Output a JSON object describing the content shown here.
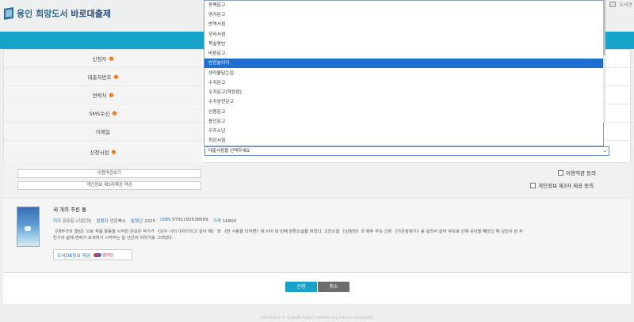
{
  "header": {
    "logo_text_main": "용인 희망도서",
    "logo_text_accent": "바로대출제",
    "top_right_text": "도서관"
  },
  "form": {
    "rows": [
      {
        "label": "신청자",
        "required": true
      },
      {
        "label": "대출자번호",
        "required": true
      },
      {
        "label": "연락처",
        "required": true
      },
      {
        "label": "SMS수신",
        "required": true
      },
      {
        "label": "이메일",
        "required": false
      },
      {
        "label": "신청서점",
        "required": true
      }
    ],
    "required_mark": "●",
    "store_select": {
      "value": "대출서점을 선택하세요",
      "arrow": "⌄"
    }
  },
  "dropdown": {
    "options": [
      "동백문고",
      "명지문고",
      "번역서점",
      "모리서점",
      "북실평빈",
      "바른문고",
      "반란놀이터",
      "생각을담는집",
      "수지문고",
      "수지문고(학원점)",
      "수지상현문고",
      "신봉문고",
      "용인문고",
      "우주소년",
      "최강서점"
    ],
    "selected": "반란놀이터"
  },
  "agreements": {
    "terms_button": "이용약관보기",
    "privacy_button": "개인정보 제3자제공 약관",
    "terms_check": "이용약관 동의",
    "privacy_check": "개인정보 제3자 제공 동의"
  },
  "book": {
    "title": "세 개의 푸른 돌",
    "author_label": "저자",
    "author": "은모든 (지은이)",
    "publisher_label": "발행자",
    "publisher": "안온북스",
    "year_label": "발행년",
    "year": "2025",
    "isbn_label": "ISBN",
    "isbn": "9791192638669",
    "price_label": "가격",
    "price": "16800",
    "desc_line1": "《애주가의 결심》으로 작품 활동을 시작한 은모든 작가가 《모두 너의 이야기이고 싶어 해》 와 《한 사람을 더하면》에 이어 네 번째 장편소설을 펴냈다. 고전소설 《심청전》과 제주 무속 신화 《가믄장애기》를 살려서 살아 부모로 인해 유년을 빼앗긴 채 성인이 된 두",
    "desc_line2": "친구의 삶에 변화가 모색하기 시작하는 일 년간의 이야기를 그려냈다.",
    "dl_button": "도서DB정보 제공",
    "dl_brand": "알라딘"
  },
  "actions": {
    "apply": "신청",
    "cancel": "취소"
  },
  "footer": {
    "text": "COPYRIGHT © YONGIN PUBLIC LIBRARY. ALL RIGHTS RESERVED."
  }
}
